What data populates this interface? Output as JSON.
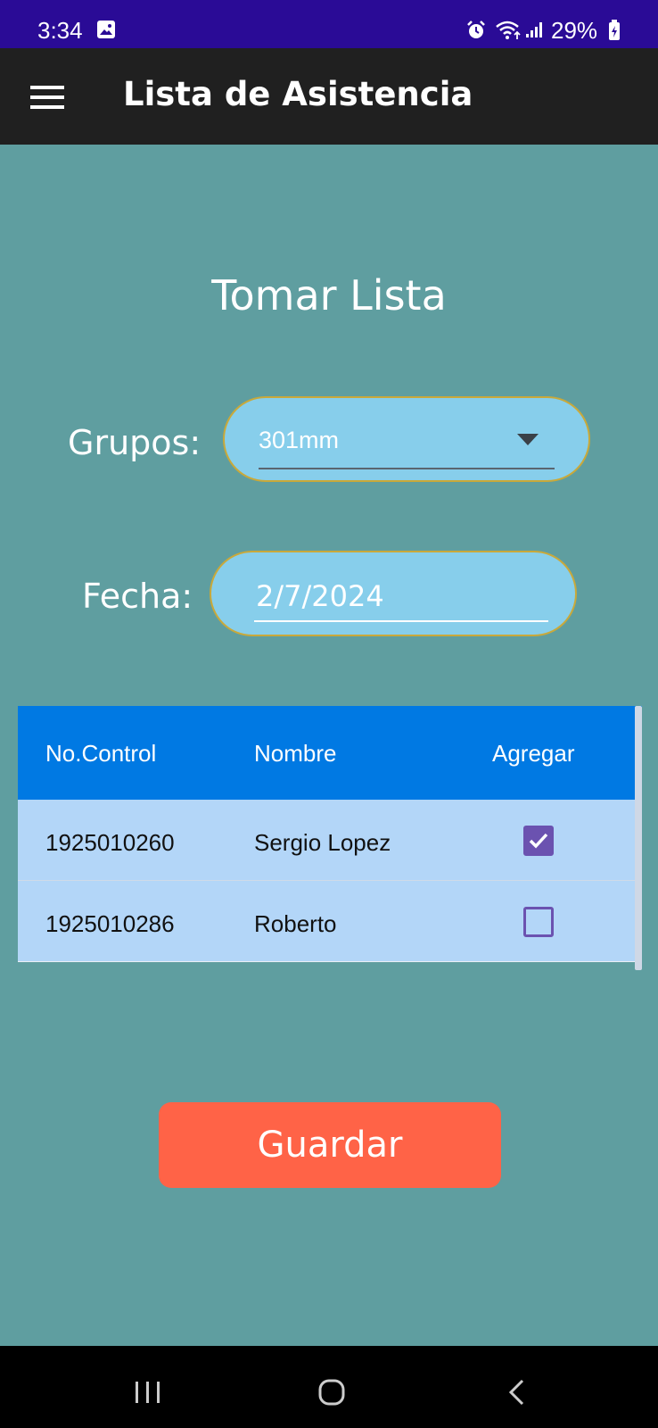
{
  "status_bar": {
    "time": "3:34",
    "battery": "29%",
    "icons": [
      "gallery-icon",
      "alarm-icon",
      "wifi-icon",
      "signal-icon",
      "battery-icon"
    ]
  },
  "app_bar": {
    "title": "Lista de Asistencia",
    "menu_icon": "hamburger-menu-icon"
  },
  "form": {
    "heading": "Tomar Lista",
    "groups_label": "Grupos:",
    "groups_value": "301mm",
    "date_label": "Fecha:",
    "date_value": "2/7/2024"
  },
  "table": {
    "headers": [
      "No.Control",
      "Nombre",
      "Agregar"
    ],
    "rows": [
      {
        "control": "1925010260",
        "name": "Sergio Lopez",
        "checked": true
      },
      {
        "control": "1925010286",
        "name": "Roberto",
        "checked": false
      }
    ]
  },
  "actions": {
    "save_label": "Guardar"
  },
  "colors": {
    "status_bar": "#2a0b96",
    "app_bar": "#202020",
    "background": "#5f9ea0",
    "pill_fill": "#87ceeb",
    "pill_border": "#c9a93a",
    "table_header": "#0079e3",
    "table_row": "#b3d6f8",
    "checkbox": "#6b52b0",
    "save_button": "#ff6347"
  },
  "nav_bar": {
    "icons": [
      "recent-apps-icon",
      "home-icon",
      "back-icon"
    ]
  }
}
